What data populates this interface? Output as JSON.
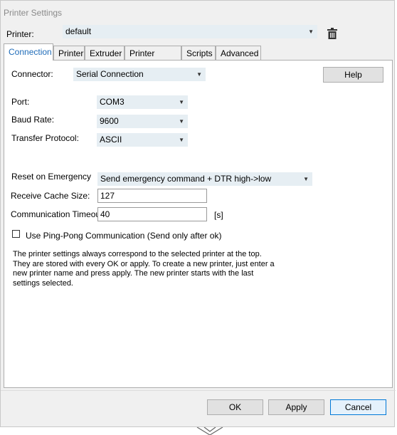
{
  "window": {
    "title": "Printer Settings"
  },
  "printer": {
    "label": "Printer:",
    "value": "default"
  },
  "tabs": [
    {
      "label": "Connection",
      "active": true
    },
    {
      "label": "Printer"
    },
    {
      "label": "Extruder"
    },
    {
      "label": "Printer Shape"
    },
    {
      "label": "Scripts"
    },
    {
      "label": "Advanced"
    }
  ],
  "connection": {
    "connector_label": "Connector:",
    "connector_value": "Serial Connection",
    "help_label": "Help",
    "port_label": "Port:",
    "port_value": "COM3",
    "baud_label": "Baud Rate:",
    "baud_value": "9600",
    "protocol_label": "Transfer Protocol:",
    "protocol_value": "ASCII",
    "reset_label": "Reset on Emergency",
    "reset_value": "Send emergency command + DTR high->low",
    "cache_label": "Receive Cache Size:",
    "cache_value": "127",
    "timeout_label": "Communication Timeout:",
    "timeout_value": "40",
    "timeout_unit": "[s]",
    "pingpong_label": "Use Ping-Pong Communication (Send only after ok)",
    "pingpong_checked": false,
    "info_text": "The printer settings always correspond to the selected printer at the top. They are stored with every OK or apply. To create a new printer, just enter a new printer name and press apply. The new printer starts with the last settings selected."
  },
  "footer": {
    "ok_label": "OK",
    "apply_label": "Apply",
    "cancel_label": "Cancel"
  },
  "icons": {
    "delete": "trash-icon",
    "dropdown": "chevron-down-icon"
  },
  "colors": {
    "active_tab_text": "#1e6bb8",
    "combo_bg": "#e6eef3",
    "default_button_border": "#0078d7"
  }
}
